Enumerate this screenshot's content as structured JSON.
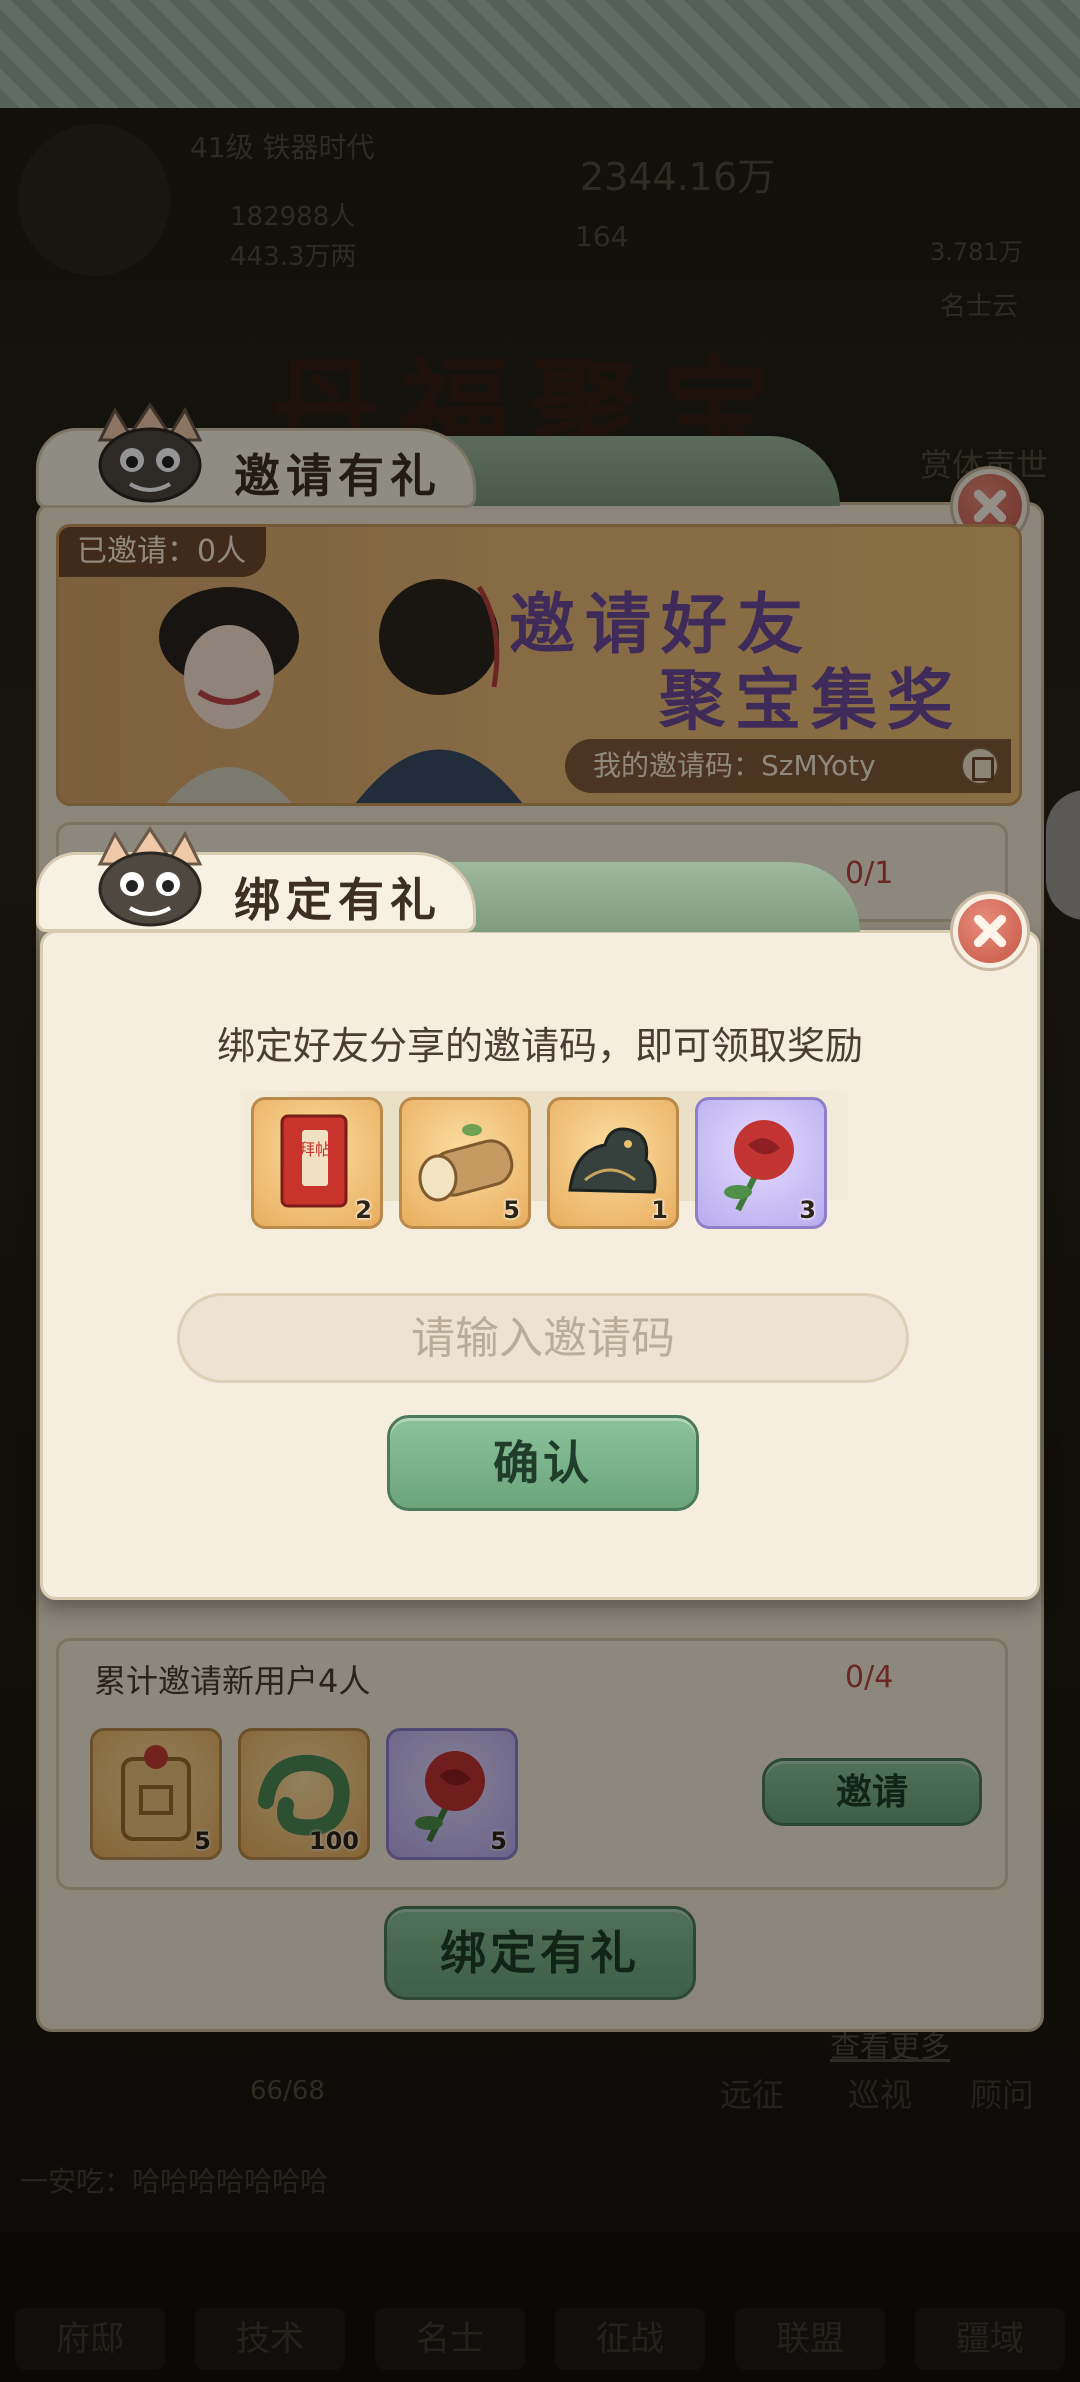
{
  "background": {
    "player_level_title": "41级 铁器时代",
    "population": "182988人",
    "wealth": "443.3万两",
    "resource_top": "2344.16万",
    "resource_mid": "164",
    "resource_right": "3.781万",
    "celebrities_label": "名士云",
    "event_title": "丹福聚宝",
    "side_button": "赏体声世",
    "stage_progress": "66/68",
    "view_more": "查看更多",
    "right_buttons": [
      "远征",
      "巡视",
      "顾问"
    ],
    "chat_line": "一安吃：哈哈哈哈哈哈哈",
    "nav": [
      "府邸",
      "技术",
      "名士",
      "征战",
      "联盟",
      "疆域"
    ]
  },
  "invite_panel": {
    "title": "邀请有礼",
    "invited_count": "已邀请：0人",
    "banner_line1": "邀请好友",
    "banner_line2": "聚宝集奖",
    "my_code_label": "我的邀请码：SzMYoty",
    "task1_progress": "0/1",
    "task2": {
      "label": "累计邀请新用户4人",
      "progress": "0/4",
      "rewards": [
        {
          "icon": "token-medal-icon",
          "count": "5"
        },
        {
          "icon": "jade-dragon-icon",
          "count": "100"
        },
        {
          "icon": "rose-icon",
          "count": "5"
        }
      ],
      "button": "邀请"
    },
    "bind_button": "绑定有礼"
  },
  "bind_dialog": {
    "title": "绑定有礼",
    "description": "绑定好友分享的邀请码，即可领取奖励",
    "rewards": [
      {
        "icon": "invitation-card-icon",
        "count": "2",
        "card_text": "拜帖",
        "rarity": "gold"
      },
      {
        "icon": "wood-log-icon",
        "count": "5",
        "rarity": "gold"
      },
      {
        "icon": "bronze-beast-icon",
        "count": "1",
        "rarity": "gold"
      },
      {
        "icon": "rose-icon",
        "count": "3",
        "rarity": "purple"
      }
    ],
    "input_placeholder": "请输入邀请码",
    "confirm_button": "确认"
  },
  "colors": {
    "accent_green": "#6ba57b",
    "close_red": "#c65645",
    "banner_text_purple": "#6b4a9c",
    "progress_red": "#b8443a"
  }
}
